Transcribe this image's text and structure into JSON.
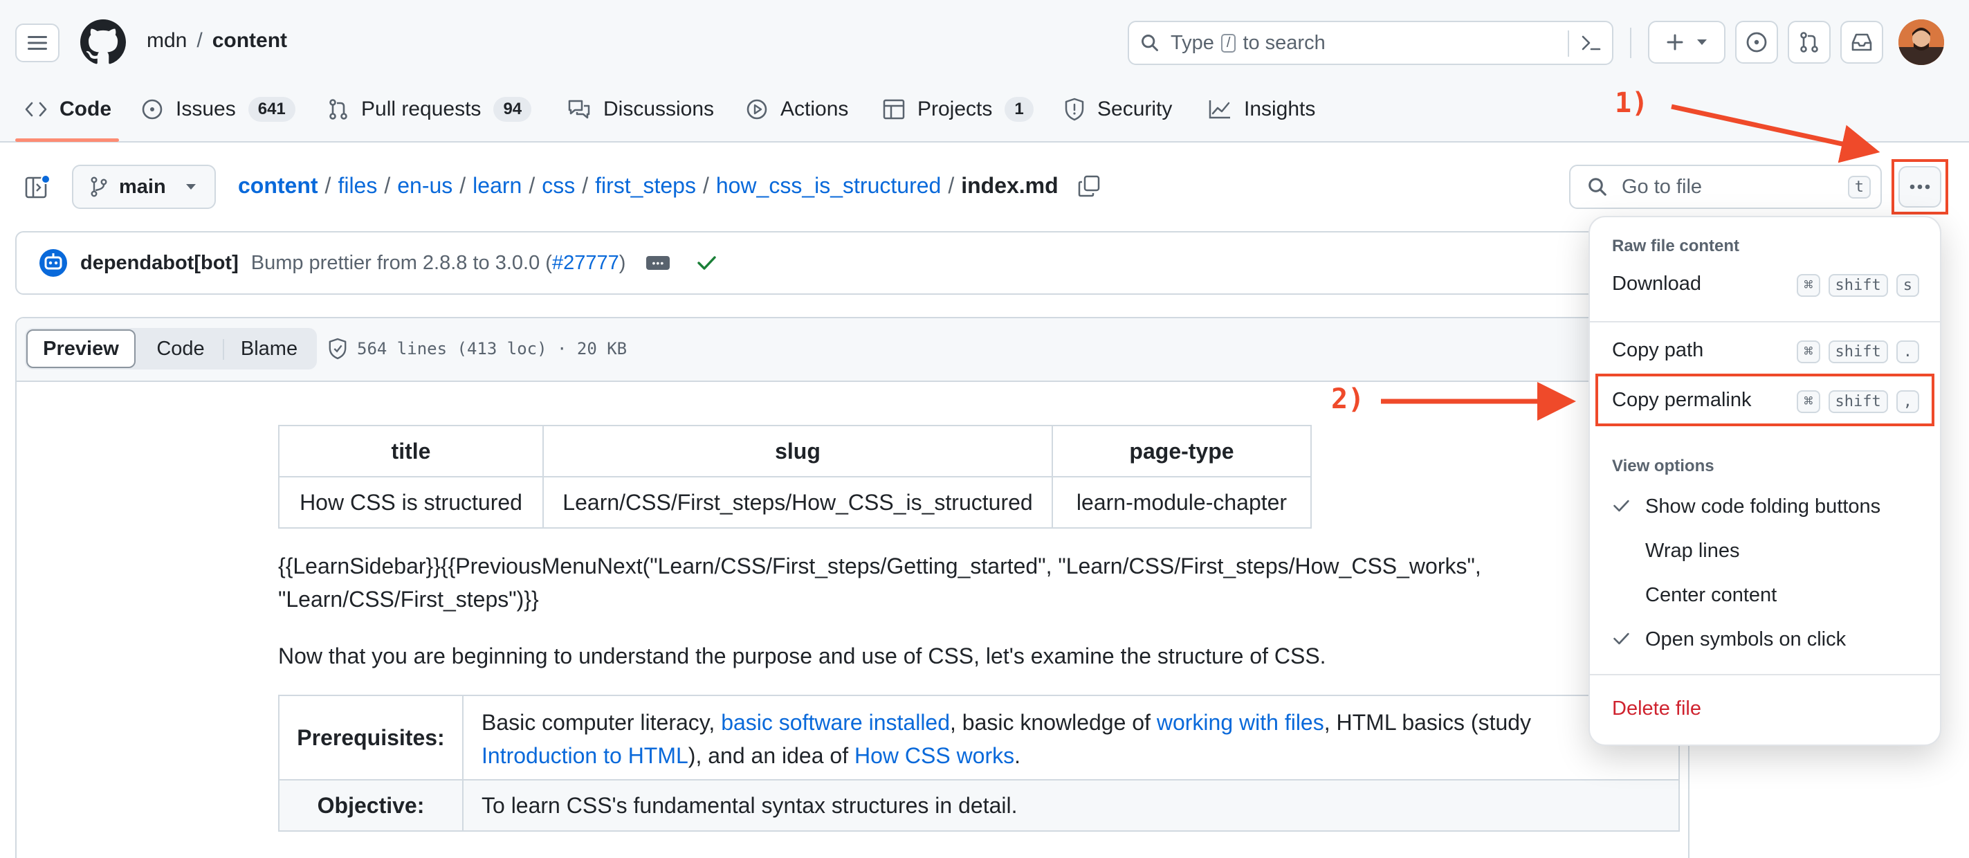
{
  "header": {
    "owner": "mdn",
    "sep": "/",
    "repo": "content",
    "search_placeholder_pre": "Type",
    "search_key": "/",
    "search_placeholder_post": "to search"
  },
  "tabs": [
    {
      "label": "Code",
      "count": ""
    },
    {
      "label": "Issues",
      "count": "641"
    },
    {
      "label": "Pull requests",
      "count": "94"
    },
    {
      "label": "Discussions",
      "count": ""
    },
    {
      "label": "Actions",
      "count": ""
    },
    {
      "label": "Projects",
      "count": "1"
    },
    {
      "label": "Security",
      "count": ""
    },
    {
      "label": "Insights",
      "count": ""
    }
  ],
  "annotations": {
    "step1": "1)",
    "step2": "2)",
    "arrow_color": "#ef4a2a"
  },
  "branch": "main",
  "breadcrumb": [
    "content",
    "files",
    "en-us",
    "learn",
    "css",
    "first_steps",
    "how_css_is_structured"
  ],
  "breadcrumb_sep": "/",
  "filename": "index.md",
  "goto_file": {
    "placeholder": "Go to file",
    "key": "t"
  },
  "commit": {
    "author": "dependabot[bot]",
    "message": "Bump prettier from 2.8.8 to 3.0.0 (",
    "pr": "#27777",
    "close": ")"
  },
  "viewbar": {
    "preview": "Preview",
    "code": "Code",
    "blame": "Blame",
    "info": "564 lines (413 loc) · 20 KB"
  },
  "meta_table": {
    "headers": [
      "title",
      "slug",
      "page-type"
    ],
    "row": [
      "How CSS is structured",
      "Learn/CSS/First_steps/How_CSS_is_structured",
      "learn-module-chapter"
    ]
  },
  "macro_line1": "{{LearnSidebar}}{{PreviousMenuNext(\"Learn/CSS/First_steps/Getting_started\", \"Learn/CSS/First_steps/How_CSS_works\",",
  "macro_line2": "\"Learn/CSS/First_steps\")}}",
  "intro": "Now that you are beginning to understand the purpose and use of CSS, let's examine the structure of CSS.",
  "prereq": {
    "label": "Prerequisites:",
    "t1": "Basic computer literacy, ",
    "l1": "basic software installed",
    "t2": ", basic knowledge of ",
    "l2": "working with files",
    "t3": ", HTML basics (study",
    "l3": "Introduction to HTML",
    "t4": "), and an idea of ",
    "l4": "How CSS works",
    "t5": "."
  },
  "objective": {
    "label": "Objective:",
    "text": "To learn CSS's fundamental syntax structures in detail."
  },
  "menu": {
    "raw_heading": "Raw file content",
    "download": "Download",
    "copy_path": "Copy path",
    "copy_permalink": "Copy permalink",
    "view_heading": "View options",
    "opt1": "Show code folding buttons",
    "opt2": "Wrap lines",
    "opt3": "Center content",
    "opt4": "Open symbols on click",
    "delete": "Delete file",
    "key_cmd": "⌘",
    "key_shift": "shift",
    "key_s": "s",
    "key_dot": ".",
    "key_comma": ","
  }
}
